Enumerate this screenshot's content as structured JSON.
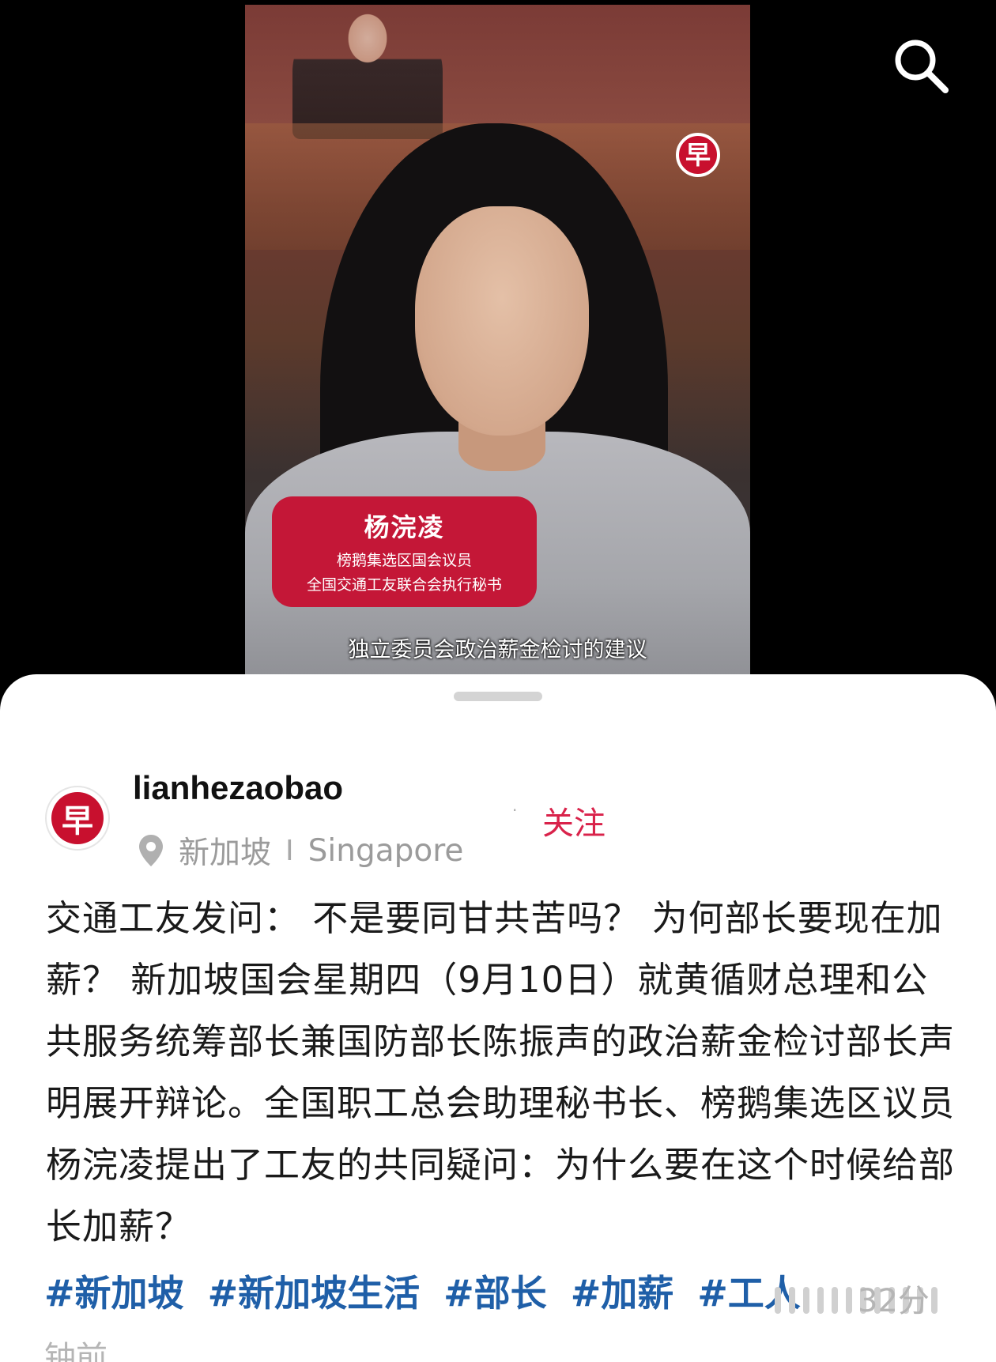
{
  "video": {
    "channel_badge": "早",
    "name_card": {
      "name": "杨浣凌",
      "line1": "榜鹅集选区国会议员",
      "line2": "全国交通工友联合会执行秘书"
    },
    "subtitle": "独立委员会政治薪金检讨的建议"
  },
  "search": {
    "icon": "search-icon"
  },
  "post": {
    "avatar_badge": "早",
    "username": "lianhezaobao",
    "location_cn": "新加坡",
    "location_sep": "I",
    "location_en": "Singapore",
    "dot": "·",
    "follow_label": "关注",
    "content": "交通工友发问： 不是要同甘共苦吗？ 为何部长要现在加薪？ 新加坡国会星期四（9月10日）就黄循财总理和公共服务统筹部长兼国防部长陈振声的政治薪金检讨部长声明展开辩论。全国职工总会助理秘书长、榜鹅集选区议员杨浣凌提出了工友的共同疑问：为什么要在这个时候给部长加薪？",
    "tags": [
      "#新加坡",
      "#新加坡生活",
      "#部长",
      "#加薪",
      "#工人"
    ],
    "time_part1": "32分",
    "time_part2": "钟前"
  },
  "colors": {
    "brand_red": "#c8102e",
    "follow_red": "#d9224a",
    "tag_blue": "#1f5fa8"
  }
}
